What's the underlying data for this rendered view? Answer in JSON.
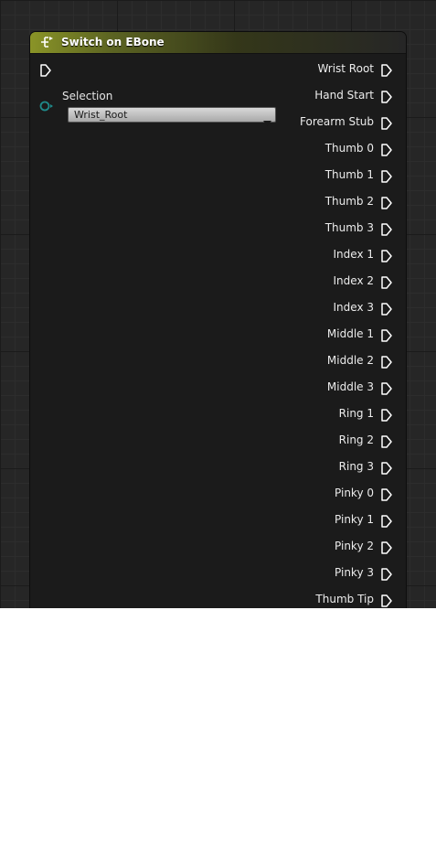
{
  "node": {
    "title": "Switch on EBone",
    "header_icon": "switch-icon",
    "header_color": "#8a9427"
  },
  "selection": {
    "label": "Selection",
    "value": "Wrist_Root",
    "pin_color": "#1f8a8a"
  },
  "outputs": [
    {
      "label": "Wrist Root"
    },
    {
      "label": "Hand Start"
    },
    {
      "label": "Forearm Stub"
    },
    {
      "label": "Thumb 0"
    },
    {
      "label": "Thumb 1"
    },
    {
      "label": "Thumb 2"
    },
    {
      "label": "Thumb 3"
    },
    {
      "label": "Index 1"
    },
    {
      "label": "Index 2"
    },
    {
      "label": "Index 3"
    },
    {
      "label": "Middle 1"
    },
    {
      "label": "Middle 2"
    },
    {
      "label": "Middle 3"
    },
    {
      "label": "Ring 1"
    },
    {
      "label": "Ring 2"
    },
    {
      "label": "Ring 3"
    },
    {
      "label": "Pinky 0"
    },
    {
      "label": "Pinky 1"
    },
    {
      "label": "Pinky 2"
    },
    {
      "label": "Pinky 3"
    },
    {
      "label": "Thumb Tip"
    }
  ]
}
